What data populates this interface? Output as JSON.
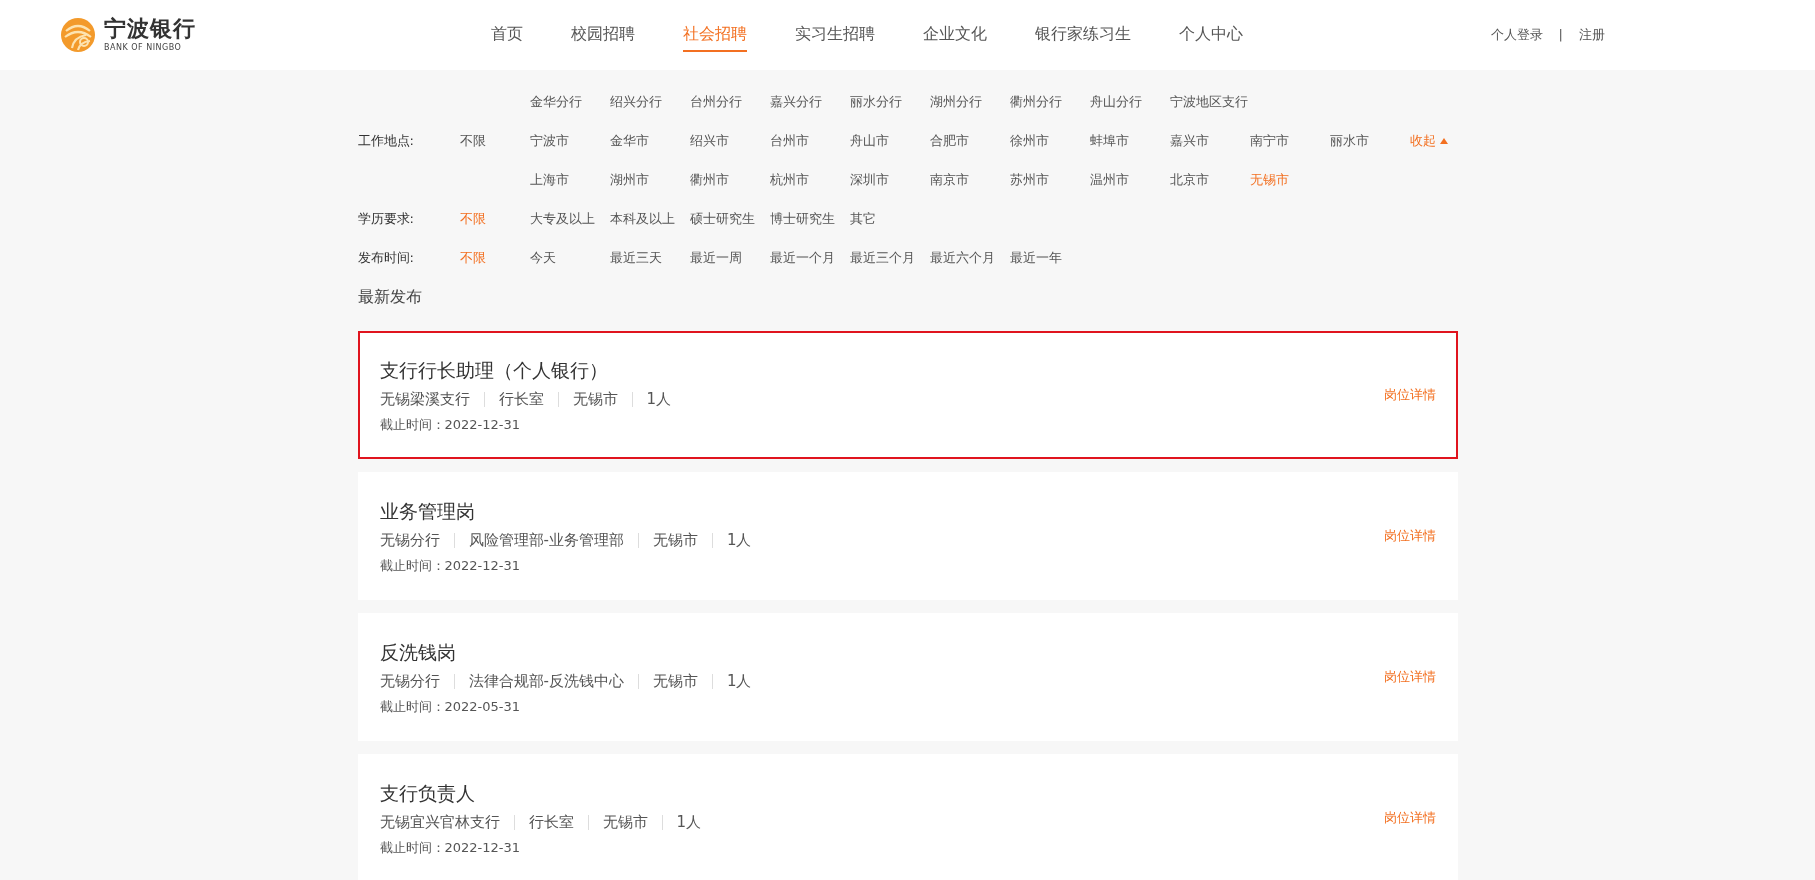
{
  "header": {
    "logo": {
      "name": "宁波银行",
      "subtitle": "BANK OF NINGBO"
    },
    "nav": [
      {
        "label": "首页",
        "selected": false
      },
      {
        "label": "校园招聘",
        "selected": false
      },
      {
        "label": "社会招聘",
        "selected": true
      },
      {
        "label": "实习生招聘",
        "selected": false
      },
      {
        "label": "企业文化",
        "selected": false
      },
      {
        "label": "银行家练习生",
        "selected": false
      },
      {
        "label": "个人中心",
        "selected": false
      }
    ],
    "account": {
      "login": "个人登录",
      "separator": "|",
      "register": "注册"
    }
  },
  "filters": [
    {
      "label": "工作地点:",
      "any": {
        "label": "不限",
        "selected": false
      },
      "toggle": "收起",
      "rows": [
        [
          {
            "label": "金华分行",
            "selected": false
          },
          {
            "label": "绍兴分行",
            "selected": false
          },
          {
            "label": "台州分行",
            "selected": false
          },
          {
            "label": "嘉兴分行",
            "selected": false
          },
          {
            "label": "丽水分行",
            "selected": false
          },
          {
            "label": "湖州分行",
            "selected": false
          },
          {
            "label": "衢州分行",
            "selected": false
          },
          {
            "label": "舟山分行",
            "selected": false
          },
          {
            "label": "宁波地区支行",
            "selected": false
          }
        ],
        [
          {
            "label": "宁波市",
            "selected": false
          },
          {
            "label": "金华市",
            "selected": false
          },
          {
            "label": "绍兴市",
            "selected": false
          },
          {
            "label": "台州市",
            "selected": false
          },
          {
            "label": "舟山市",
            "selected": false
          },
          {
            "label": "合肥市",
            "selected": false
          },
          {
            "label": "徐州市",
            "selected": false
          },
          {
            "label": "蚌埠市",
            "selected": false
          },
          {
            "label": "嘉兴市",
            "selected": false
          },
          {
            "label": "南宁市",
            "selected": false
          },
          {
            "label": "丽水市",
            "selected": false
          }
        ],
        [
          {
            "label": "上海市",
            "selected": false
          },
          {
            "label": "湖州市",
            "selected": false
          },
          {
            "label": "衢州市",
            "selected": false
          },
          {
            "label": "杭州市",
            "selected": false
          },
          {
            "label": "深圳市",
            "selected": false
          },
          {
            "label": "南京市",
            "selected": false
          },
          {
            "label": "苏州市",
            "selected": false
          },
          {
            "label": "温州市",
            "selected": false
          },
          {
            "label": "北京市",
            "selected": false
          },
          {
            "label": "无锡市",
            "selected": true
          }
        ]
      ]
    },
    {
      "label": "学历要求:",
      "any": {
        "label": "不限",
        "selected": true
      },
      "rows": [
        [
          {
            "label": "大专及以上",
            "selected": false
          },
          {
            "label": "本科及以上",
            "selected": false
          },
          {
            "label": "硕士研究生",
            "selected": false
          },
          {
            "label": "博士研究生",
            "selected": false
          },
          {
            "label": "其它",
            "selected": false
          }
        ]
      ]
    },
    {
      "label": "发布时间:",
      "any": {
        "label": "不限",
        "selected": true
      },
      "rows": [
        [
          {
            "label": "今天",
            "selected": false
          },
          {
            "label": "最近三天",
            "selected": false
          },
          {
            "label": "最近一周",
            "selected": false
          },
          {
            "label": "最近一个月",
            "selected": false
          },
          {
            "label": "最近三个月",
            "selected": false
          },
          {
            "label": "最近六个月",
            "selected": false
          },
          {
            "label": "最近一年",
            "selected": false
          }
        ]
      ]
    }
  ],
  "section_title": "最新发布",
  "jobs": [
    {
      "title": "支行行长助理（个人银行）",
      "meta": [
        "无锡梁溪支行",
        "行长室",
        "无锡市",
        "1人"
      ],
      "deadline": "截止时间：2022-12-31",
      "link": "岗位详情",
      "highlighted": true
    },
    {
      "title": "业务管理岗",
      "meta": [
        "无锡分行",
        "风险管理部-业务管理部",
        "无锡市",
        "1人"
      ],
      "deadline": "截止时间：2022-12-31",
      "link": "岗位详情",
      "highlighted": false
    },
    {
      "title": "反洗钱岗",
      "meta": [
        "无锡分行",
        "法律合规部-反洗钱中心",
        "无锡市",
        "1人"
      ],
      "deadline": "截止时间：2022-05-31",
      "link": "岗位详情",
      "highlighted": false
    },
    {
      "title": "支行负责人",
      "meta": [
        "无锡宜兴官林支行",
        "行长室",
        "无锡市",
        "1人"
      ],
      "deadline": "截止时间：2022-12-31",
      "link": "岗位详情",
      "highlighted": false
    }
  ]
}
